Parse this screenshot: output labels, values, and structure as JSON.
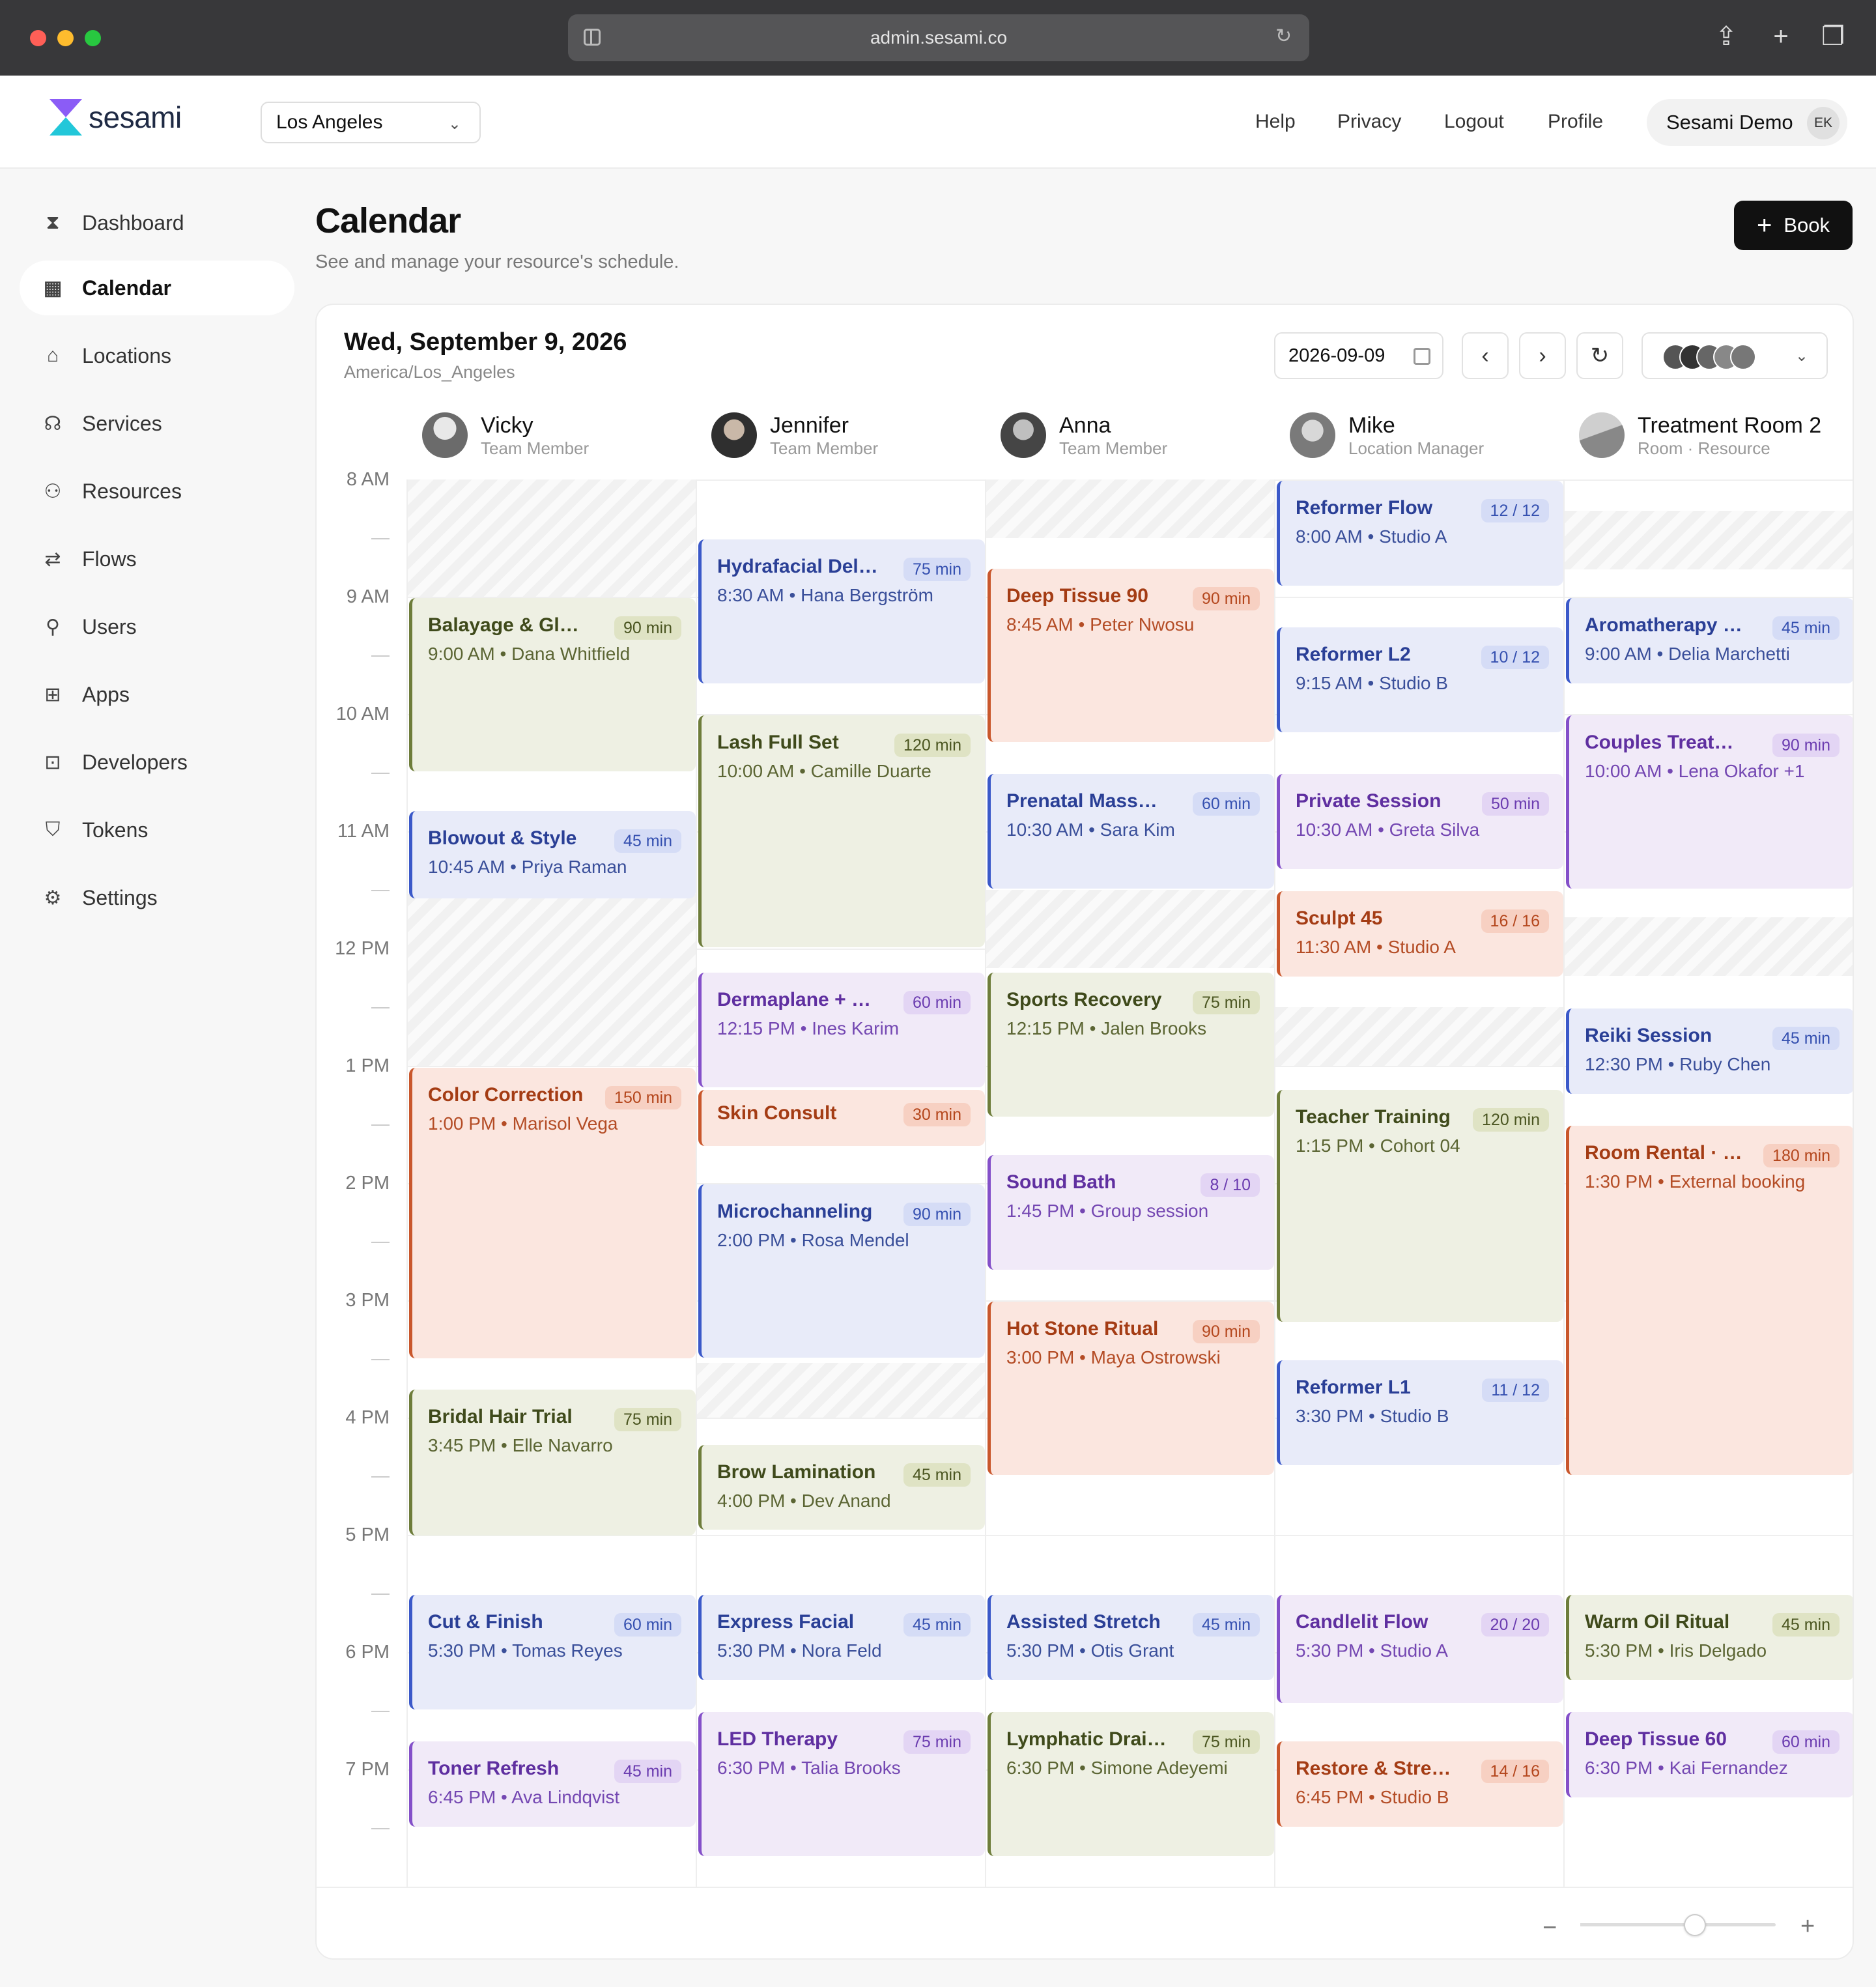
{
  "browser": {
    "url": "admin.sesami.co"
  },
  "app": {
    "logo_text": "sesami",
    "location": "Los Angeles",
    "user_name": "Sesami Demo",
    "user_initials": "EK"
  },
  "topnav": [
    "Help",
    "Privacy",
    "Logout",
    "Profile"
  ],
  "sidebar": {
    "items": [
      {
        "label": "Dashboard",
        "icon": "hourglass-icon",
        "active": false
      },
      {
        "label": "Calendar",
        "icon": "calendar-icon",
        "active": true
      },
      {
        "label": "Locations",
        "icon": "store-icon",
        "active": false
      },
      {
        "label": "Services",
        "icon": "headset-icon",
        "active": false
      },
      {
        "label": "Resources",
        "icon": "people-icon",
        "active": false
      },
      {
        "label": "Flows",
        "icon": "repeat-icon",
        "active": false
      },
      {
        "label": "Users",
        "icon": "user-icon",
        "active": false
      },
      {
        "label": "Apps",
        "icon": "apps-grid-icon",
        "active": false
      },
      {
        "label": "Developers",
        "icon": "terminal-icon",
        "active": false
      },
      {
        "label": "Tokens",
        "icon": "shield-icon",
        "active": false
      },
      {
        "label": "Settings",
        "icon": "gear-icon",
        "active": false
      }
    ]
  },
  "page": {
    "title": "Calendar",
    "subtitle": "See and manage your resource's schedule.",
    "book_label": "Book"
  },
  "calendar": {
    "date_title": "Wed, September 9, 2026",
    "timezone": "America/Los_Angeles",
    "date_value": "2026-09-09",
    "resources": [
      {
        "name": "Vicky",
        "role": "Team Member",
        "avatar_color": "#6b6b6b"
      },
      {
        "name": "Jennifer",
        "role": "Team Member",
        "avatar_color": "#3d3d3d"
      },
      {
        "name": "Anna",
        "role": "Team Member",
        "avatar_color": "#505050"
      },
      {
        "name": "Mike",
        "role": "Location Manager",
        "avatar_color": "#8a8a8a"
      },
      {
        "name": "Treatment Room 2",
        "role": "Room · Resource",
        "avatar_color": "#9a9a9a"
      }
    ],
    "hours": [
      "8 AM",
      "9 AM",
      "10 AM",
      "11 AM",
      "12 PM",
      "1 PM",
      "2 PM",
      "3 PM",
      "4 PM",
      "5 PM",
      "6 PM",
      "7 PM"
    ],
    "events": [
      {
        "col": 0,
        "title": "Balayage & Gloss",
        "badge": "90 min",
        "sub": "9:00 AM • Dana Whitfield",
        "color": "g"
      },
      {
        "col": 0,
        "title": "Blowout & Style",
        "badge": "45 min",
        "sub": "10:45 AM • Priya Raman",
        "color": "b_"
      },
      {
        "col": 0,
        "title": "Color Correction",
        "badge": "150 min",
        "sub": "1:00 PM • Marisol Vega",
        "color": "o"
      },
      {
        "col": 0,
        "title": "Bridal Hair Trial",
        "badge": "75 min",
        "sub": "3:45 PM • Elle Navarro",
        "color": "g"
      },
      {
        "col": 0,
        "title": "Cut & Finish",
        "badge": "60 min",
        "sub": "5:30 PM • Tomas Reyes",
        "color": "b_"
      },
      {
        "col": 0,
        "title": "Toner Refresh",
        "badge": "45 min",
        "sub": "6:45 PM • Ava Lindqvist",
        "color": "p"
      },
      {
        "col": 1,
        "title": "Hydrafacial Deluxe",
        "badge": "75 min",
        "sub": "8:30 AM • Hana Bergström",
        "color": "b_"
      },
      {
        "col": 1,
        "title": "Lash Full Set",
        "badge": "120 min",
        "sub": "10:00 AM • Camille Duarte",
        "color": "g"
      },
      {
        "col": 1,
        "title": "Dermaplane + Peel",
        "badge": "60 min",
        "sub": "12:15 PM • Ines Karim",
        "color": "p"
      },
      {
        "col": 1,
        "title": "Skin Consult",
        "badge": "30 min",
        "sub": "",
        "color": "o"
      },
      {
        "col": 1,
        "title": "Microchanneling",
        "badge": "90 min",
        "sub": "2:00 PM • Rosa Mendel",
        "color": "b_"
      },
      {
        "col": 1,
        "title": "Brow Lamination",
        "badge": "45 min",
        "sub": "4:00 PM • Dev Anand",
        "color": "g"
      },
      {
        "col": 1,
        "title": "Express Facial",
        "badge": "45 min",
        "sub": "5:30 PM • Nora Feld",
        "color": "b_"
      },
      {
        "col": 1,
        "title": "LED Therapy",
        "badge": "75 min",
        "sub": "6:30 PM • Talia Brooks",
        "color": "p"
      },
      {
        "col": 2,
        "title": "Deep Tissue 90",
        "badge": "90 min",
        "sub": "8:45 AM • Peter Nwosu",
        "color": "o"
      },
      {
        "col": 2,
        "title": "Prenatal Massage",
        "badge": "60 min",
        "sub": "10:30 AM • Sara Kim",
        "color": "b_"
      },
      {
        "col": 2,
        "title": "Sports Recovery",
        "badge": "75 min",
        "sub": "12:15 PM • Jalen Brooks",
        "color": "g"
      },
      {
        "col": 2,
        "title": "Sound Bath",
        "badge": "8 / 10",
        "sub": "1:45 PM • Group session",
        "color": "p"
      },
      {
        "col": 2,
        "title": "Hot Stone Ritual",
        "badge": "90 min",
        "sub": "3:00 PM • Maya Ostrowski",
        "color": "o"
      },
      {
        "col": 2,
        "title": "Assisted Stretch",
        "badge": "45 min",
        "sub": "5:30 PM • Otis Grant",
        "color": "b_"
      },
      {
        "col": 2,
        "title": "Lymphatic Drainage",
        "badge": "75 min",
        "sub": "6:30 PM • Simone Adeyemi",
        "color": "g"
      },
      {
        "col": 3,
        "title": "Reformer Flow",
        "badge": "12 / 12",
        "sub": "8:00 AM • Studio A",
        "color": "b_"
      },
      {
        "col": 3,
        "title": "Reformer L2",
        "badge": "10 / 12",
        "sub": "9:15 AM • Studio B",
        "color": "b_"
      },
      {
        "col": 3,
        "title": "Private Session",
        "badge": "50 min",
        "sub": "10:30 AM • Greta Silva",
        "color": "p"
      },
      {
        "col": 3,
        "title": "Sculpt 45",
        "badge": "16 / 16",
        "sub": "11:30 AM • Studio A",
        "color": "o"
      },
      {
        "col": 3,
        "title": "Teacher Training",
        "badge": "120 min",
        "sub": "1:15 PM • Cohort 04",
        "color": "g"
      },
      {
        "col": 3,
        "title": "Reformer L1",
        "badge": "11 / 12",
        "sub": "3:30 PM • Studio B",
        "color": "b_"
      },
      {
        "col": 3,
        "title": "Candlelit Flow",
        "badge": "20 / 20",
        "sub": "5:30 PM • Studio A",
        "color": "p"
      },
      {
        "col": 3,
        "title": "Restore & Stretch",
        "badge": "14 / 16",
        "sub": "6:45 PM • Studio B",
        "color": "o"
      },
      {
        "col": 4,
        "title": "Aromatherapy Massage",
        "badge": "45 min",
        "sub": "9:00 AM • Delia Marchetti",
        "color": "b_"
      },
      {
        "col": 4,
        "title": "Couples Treatment",
        "badge": "90 min",
        "sub": "10:00 AM • Lena Okafor +1",
        "color": "p"
      },
      {
        "col": 4,
        "title": "Reiki Session",
        "badge": "45 min",
        "sub": "12:30 PM • Ruby Chen",
        "color": "b_"
      },
      {
        "col": 4,
        "title": "Room Rental · External",
        "badge": "180 min",
        "sub": "1:30 PM • External booking",
        "color": "o"
      },
      {
        "col": 4,
        "title": "Warm Oil Ritual",
        "badge": "45 min",
        "sub": "5:30 PM • Iris Delgado",
        "color": "g"
      },
      {
        "col": 4,
        "title": "Deep Tissue 60",
        "badge": "60 min",
        "sub": "6:30 PM • Kai Fernandez",
        "color": "p"
      }
    ]
  },
  "zoom": {
    "level": 0.42
  }
}
